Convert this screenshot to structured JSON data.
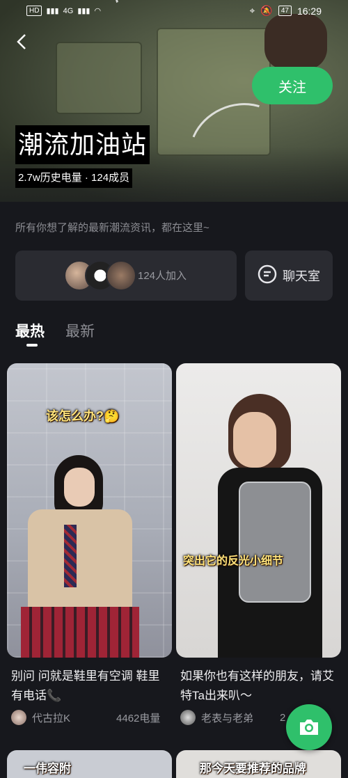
{
  "status": {
    "net": "HD",
    "sig": "4G",
    "battery": "47",
    "time": "16:29"
  },
  "header": {
    "follow_label": "关注",
    "title": "潮流加油站",
    "stats": "2.7w历史电量 · 124成员"
  },
  "description": "所有你想了解的最新潮流资讯，都在这里~",
  "members": {
    "count_label": "124人加入"
  },
  "chat": {
    "label": "聊天室"
  },
  "tabs": [
    {
      "label": "最热"
    },
    {
      "label": "最新"
    }
  ],
  "posts": [
    {
      "caption": "该怎么办?🤔",
      "title": "别问 问就是鞋里有空调 鞋里有电话📞",
      "author": "代古拉K",
      "energy": "4462电量"
    },
    {
      "caption": "突出它的反光小细节",
      "title": "如果你也有这样的朋友，请艾特Ta出来叭～",
      "author": "老表与老弟",
      "energy": "2"
    }
  ],
  "peek": [
    {
      "caption": "一伟容附"
    },
    {
      "caption": "那今天要推荐的品牌"
    }
  ],
  "colors": {
    "accent": "#2fc06b",
    "background": "#17181d",
    "card": "#2a2b31"
  }
}
